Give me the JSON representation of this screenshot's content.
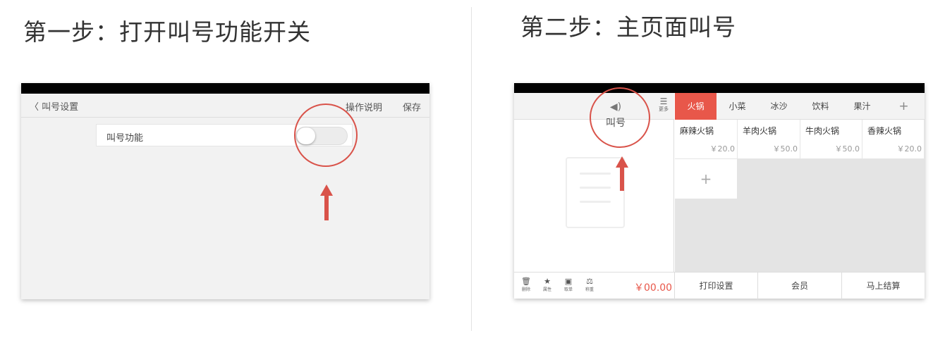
{
  "step1": {
    "title": "第一步：打开叫号功能开关",
    "back_label": "〈 叫号设置",
    "help_label": "操作说明",
    "save_label": "保存",
    "row_label": "叫号功能",
    "toggle_on": false
  },
  "step2": {
    "title": "第二步：主页面叫号",
    "call_icon": "speaker-icon",
    "call_label": "叫号",
    "more_label": "更多",
    "tabs": [
      "火锅",
      "小菜",
      "冰沙",
      "饮料",
      "果汁",
      "+"
    ],
    "active_tab": "火锅",
    "dishes": [
      {
        "name": "麻辣火锅",
        "price": "￥20.0"
      },
      {
        "name": "羊肉火锅",
        "price": "￥50.0"
      },
      {
        "name": "牛肉火锅",
        "price": "￥50.0"
      },
      {
        "name": "香辣火锅",
        "price": "￥20.0"
      }
    ],
    "add_label": "+",
    "tools": [
      {
        "icon": "trash-icon",
        "label": "删除"
      },
      {
        "icon": "star-icon",
        "label": "属性"
      },
      {
        "icon": "order-icon",
        "label": "取单"
      },
      {
        "icon": "scale-icon",
        "label": "称重"
      }
    ],
    "amount": "￥00.00",
    "buttons": [
      "打印设置",
      "会员",
      "马上结算"
    ]
  },
  "colors": {
    "accent": "#e8574a",
    "annotation": "#d9534a"
  }
}
